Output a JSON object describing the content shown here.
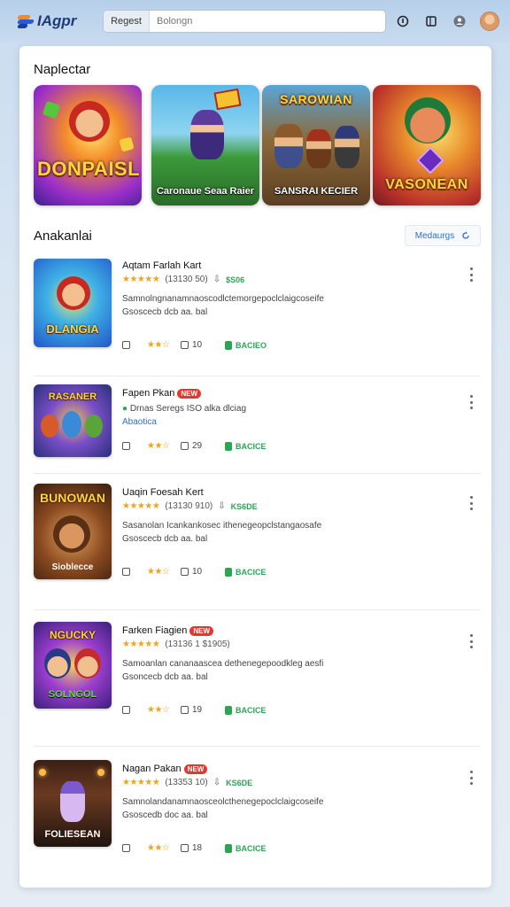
{
  "app": {
    "name": "IAgpr"
  },
  "search": {
    "scope": "Regest",
    "placeholder": "Bolongn"
  },
  "featured": {
    "title": "Naplectar",
    "cards": [
      {
        "label": "DONPAISL",
        "sub": ""
      },
      {
        "label": "Caronaue Seaa Raier",
        "sub": ""
      },
      {
        "label": "SANSRAI KECIER",
        "sub": "SAROWIAN"
      },
      {
        "label": "VASONEAN",
        "sub": ""
      }
    ]
  },
  "list": {
    "title": "Anakanlai",
    "button": "Medaurgs",
    "items": [
      {
        "title": "Aqtam Farlah Kart",
        "badge": "",
        "rating": "★★★★★",
        "count": "(13130 50)",
        "size": "$S06",
        "desc1": "Samnolngnanamnaoscodlctemorgepoclclaigcoseife",
        "desc2": "Gsoscecb dcb aa. bal",
        "price_stars": "★★☆",
        "downloads": "10",
        "tag": "BACIEO",
        "thumb": "DLANGIA"
      },
      {
        "title": "Fapen Pkan",
        "badge": "NEW",
        "rating": "",
        "count": "",
        "size": "",
        "desc1": "Drnas Seregs ISO alka dlciag",
        "desc2": "Abaotica",
        "price_stars": "★★☆",
        "downloads": "29",
        "tag": "BACICE",
        "thumb": "RASANER"
      },
      {
        "title": "Uaqin Foesah Kert",
        "badge": "",
        "rating": "★★★★★",
        "count": "(13130 910)",
        "size": "KS6DE",
        "desc1": "Sasanolan Icankankosec ithenegeopclstangaosafe",
        "desc2": "Gsoscecb dcb aa. bal",
        "price_stars": "★★☆",
        "downloads": "10",
        "tag": "BACICE",
        "thumb": "BUNOWAN"
      },
      {
        "title": "Farken Fiagien",
        "badge": "NEW",
        "rating": "★★★★★",
        "count": "(13136 1 $1905)",
        "size": "",
        "desc1": "Samoanlan cananaascea dethenegepoodkleg aesfi",
        "desc2": "Gsoncecb dcb aa. bal",
        "price_stars": "★★☆",
        "downloads": "19",
        "tag": "BACICE",
        "thumb": "NGUCKY"
      },
      {
        "title": "Nagan Pakan",
        "badge": "NEW",
        "rating": "★★★★★",
        "count": "(13353 10)",
        "size": "KS6DE",
        "desc1": "Samnolandanamnaosceolcthenegepoclclaigcoseife",
        "desc2": "Gsoscedb doc aa. bal",
        "price_stars": "★★☆",
        "downloads": "18",
        "tag": "BACICE",
        "thumb": "FOLIESEAN"
      }
    ]
  },
  "colors": {
    "accent": "#2f6fc6",
    "badge": "#e4382f",
    "rating": "#f2a21b",
    "tag": "#2aa653"
  }
}
